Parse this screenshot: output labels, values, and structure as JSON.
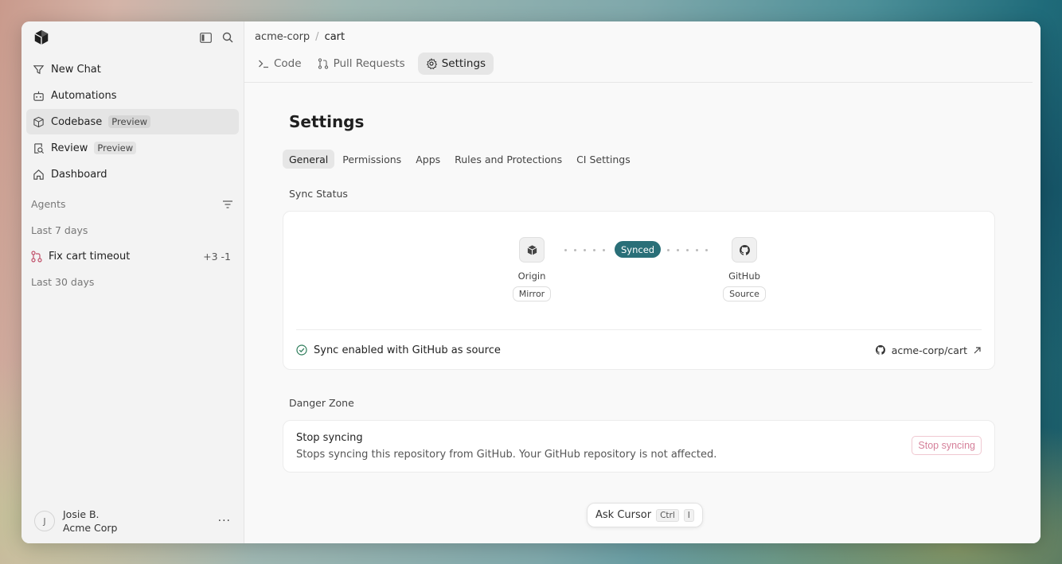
{
  "sidebar": {
    "nav": [
      {
        "label": "New Chat",
        "icon": "new-chat-icon"
      },
      {
        "label": "Automations",
        "icon": "automations-icon"
      },
      {
        "label": "Codebase",
        "badge": "Preview",
        "icon": "cube-icon",
        "active": true
      },
      {
        "label": "Review",
        "badge": "Preview",
        "icon": "review-icon"
      },
      {
        "label": "Dashboard",
        "icon": "home-icon"
      }
    ],
    "agents_label": "Agents",
    "last7_label": "Last 7 days",
    "agent_item": {
      "label": "Fix cart timeout",
      "diff": "+3 -1"
    },
    "last30_label": "Last 30 days",
    "user": {
      "initial": "J",
      "name": "Josie B.",
      "org": "Acme Corp",
      "more": "···"
    }
  },
  "breadcrumb": {
    "org": "acme-corp",
    "sep": "/",
    "repo": "cart"
  },
  "tabs": [
    {
      "label": "Code",
      "icon": "terminal-icon"
    },
    {
      "label": "Pull Requests",
      "icon": "pull-request-icon"
    },
    {
      "label": "Settings",
      "icon": "gear-icon",
      "active": true
    }
  ],
  "settings": {
    "title": "Settings",
    "subtabs": [
      "General",
      "Permissions",
      "Apps",
      "Rules and Protections",
      "CI Settings"
    ],
    "sync_heading": "Sync Status",
    "origin": {
      "name": "Origin",
      "role": "Mirror"
    },
    "github": {
      "name": "GitHub",
      "role": "Source"
    },
    "sync_badge": "Synced",
    "sync_message": "Sync enabled with GitHub as source",
    "repo_link": "acme-corp/cart",
    "danger_heading": "Danger Zone",
    "danger_title": "Stop syncing",
    "danger_desc": "Stops syncing this repository from GitHub. Your GitHub repository is not affected.",
    "danger_button": "Stop syncing"
  },
  "ask": {
    "label": "Ask Cursor",
    "key1": "Ctrl",
    "key2": "I"
  },
  "colors": {
    "accent": "#2a6f78",
    "danger": "#d5809a",
    "success": "#2f7d5b"
  }
}
